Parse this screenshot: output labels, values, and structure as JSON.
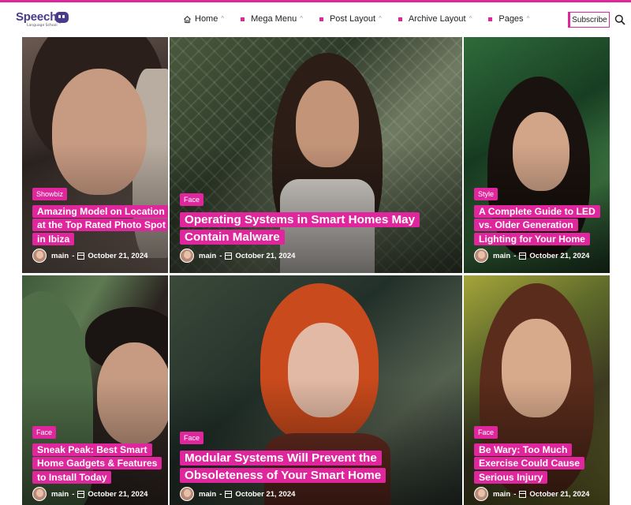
{
  "site": {
    "logo_text": "Speech",
    "logo_subtitle": "Language School",
    "accent_color": "#e0269c"
  },
  "nav": {
    "items": [
      {
        "label": "Home",
        "icon": "home-icon"
      },
      {
        "label": "Mega Menu"
      },
      {
        "label": "Post Layout"
      },
      {
        "label": "Archive Layout"
      },
      {
        "label": "Pages"
      }
    ],
    "chevron": "^"
  },
  "header": {
    "subscribe_label": "Subscribe",
    "search_icon": "search-icon"
  },
  "posts": [
    {
      "category": "Showbiz",
      "title": "Amazing Model on Location at the Top Rated Photo Spot in Ibiza",
      "author": "main",
      "date": "October 21, 2024"
    },
    {
      "category": "Face",
      "title": "Operating Systems in Smart Homes May Contain Malware",
      "author": "main",
      "date": "October 21, 2024"
    },
    {
      "category": "Style",
      "title": "A Complete Guide to LED vs. Older Generation Lighting for Your Home",
      "author": "main",
      "date": "October 21, 2024"
    },
    {
      "category": "Face",
      "title": "Sneak Peak: Best Smart Home Gadgets & Features to Install Today",
      "author": "main",
      "date": "October 21, 2024"
    },
    {
      "category": "Face",
      "title": "Modular Systems Will Prevent the Obsoleteness of Your Smart Home",
      "author": "main",
      "date": "October 21, 2024"
    },
    {
      "category": "Face",
      "title": "Be Wary: Too Much Exercise Could Cause Serious Injury",
      "author": "main",
      "date": "October 21, 2024"
    }
  ],
  "meta_separator": "-"
}
